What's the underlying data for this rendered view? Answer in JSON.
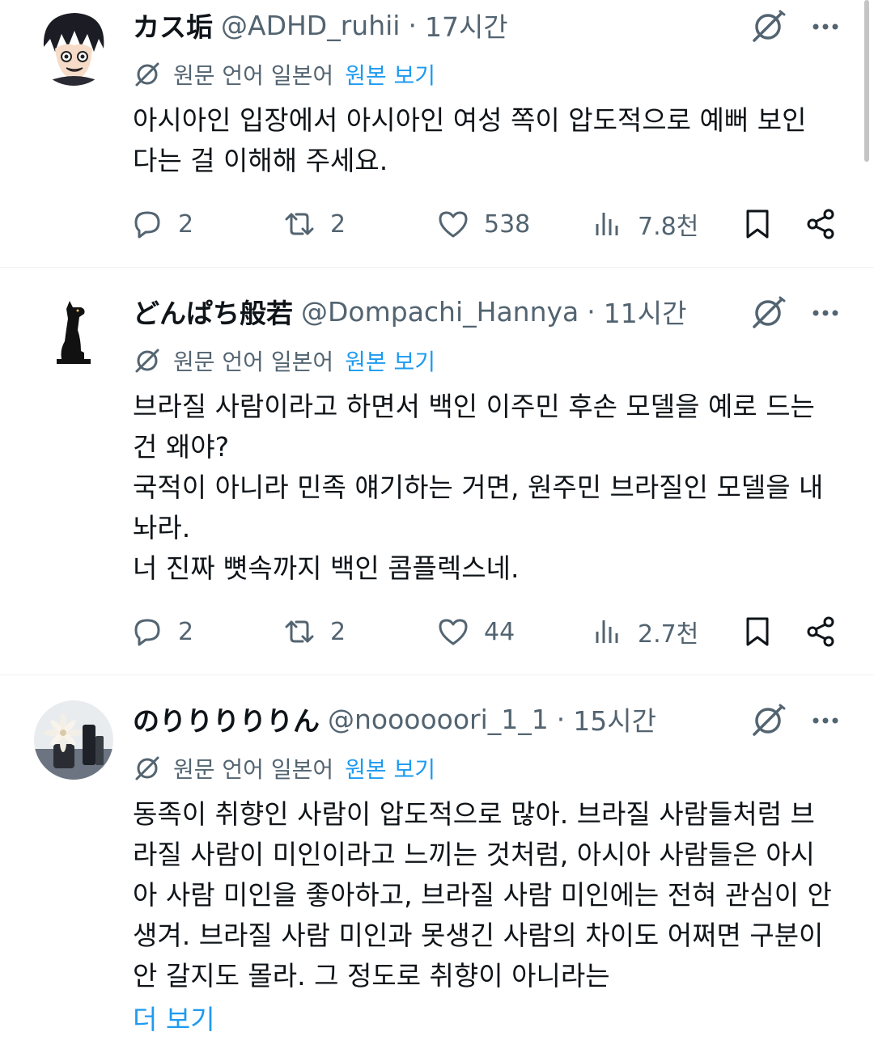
{
  "tweets": [
    {
      "display_name": "カス垢",
      "handle": "@ADHD_ruhii",
      "separator": "·",
      "time": "17시간",
      "avatar_icon": "anime-character-avatar",
      "translate": {
        "label": "원문 언어 일본어",
        "link": "원본 보기"
      },
      "body_lines": [
        "아시아인 입장에서 아시아인 여성 쪽이 압도적으로 예뻐 보인",
        "다는 걸 이해해 주세요."
      ],
      "stats": {
        "replies": "2",
        "retweets": "2",
        "likes": "538",
        "views": "7.8천"
      }
    },
    {
      "display_name": "どんぱち般若",
      "handle": "@Dompachi_Hannya",
      "separator": "·",
      "time": "11시간",
      "avatar_icon": "black-dog-statue-avatar",
      "translate": {
        "label": "원문 언어 일본어",
        "link": "원본 보기"
      },
      "body_lines": [
        "브라질 사람이라고 하면서 백인 이주민 후손 모델을 예로 드는",
        "건 왜야?",
        "국적이 아니라 민족 얘기하는 거면, 원주민 브라질인 모델을 내",
        "놔라.",
        "너 진짜 뼛속까지 백인 콤플렉스네."
      ],
      "stats": {
        "replies": "2",
        "retweets": "2",
        "likes": "44",
        "views": "2.7천"
      }
    },
    {
      "display_name": "のりりりりりん",
      "handle": "@noooooori_1_1",
      "separator": "·",
      "time": "15시간",
      "avatar_icon": "flower-vase-avatar",
      "translate": {
        "label": "원문 언어 일본어",
        "link": "원본 보기"
      },
      "body_lines": [
        "동족이 취향인 사람이 압도적으로 많아. 브라질 사람들처럼 브",
        "라질 사람이 미인이라고 느끼는 것처럼, 아시아 사람들은 아시",
        "아 사람 미인을 좋아하고, 브라질 사람 미인에는 전혀 관심이 안",
        "생겨. 브라질 사람 미인과 못생긴 사람의 차이도 어쩌면 구분이",
        "안 갈지도 몰라. 그 정도로 취향이 아니라는"
      ],
      "show_more": "더 보기"
    }
  ],
  "colors": {
    "text": "#0f1419",
    "muted": "#536471",
    "link": "#1d9bf0",
    "divider": "#eff3f4"
  }
}
